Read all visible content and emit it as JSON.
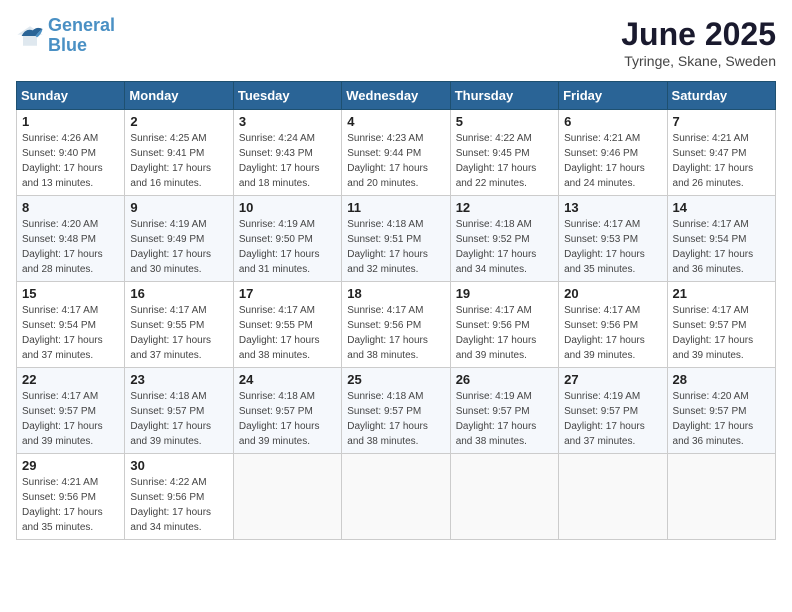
{
  "header": {
    "logo_line1": "General",
    "logo_line2": "Blue",
    "title": "June 2025",
    "subtitle": "Tyringe, Skane, Sweden"
  },
  "columns": [
    "Sunday",
    "Monday",
    "Tuesday",
    "Wednesday",
    "Thursday",
    "Friday",
    "Saturday"
  ],
  "weeks": [
    [
      {
        "day": "1",
        "sunrise": "4:26 AM",
        "sunset": "9:40 PM",
        "daylight": "17 hours and 13 minutes."
      },
      {
        "day": "2",
        "sunrise": "4:25 AM",
        "sunset": "9:41 PM",
        "daylight": "17 hours and 16 minutes."
      },
      {
        "day": "3",
        "sunrise": "4:24 AM",
        "sunset": "9:43 PM",
        "daylight": "17 hours and 18 minutes."
      },
      {
        "day": "4",
        "sunrise": "4:23 AM",
        "sunset": "9:44 PM",
        "daylight": "17 hours and 20 minutes."
      },
      {
        "day": "5",
        "sunrise": "4:22 AM",
        "sunset": "9:45 PM",
        "daylight": "17 hours and 22 minutes."
      },
      {
        "day": "6",
        "sunrise": "4:21 AM",
        "sunset": "9:46 PM",
        "daylight": "17 hours and 24 minutes."
      },
      {
        "day": "7",
        "sunrise": "4:21 AM",
        "sunset": "9:47 PM",
        "daylight": "17 hours and 26 minutes."
      }
    ],
    [
      {
        "day": "8",
        "sunrise": "4:20 AM",
        "sunset": "9:48 PM",
        "daylight": "17 hours and 28 minutes."
      },
      {
        "day": "9",
        "sunrise": "4:19 AM",
        "sunset": "9:49 PM",
        "daylight": "17 hours and 30 minutes."
      },
      {
        "day": "10",
        "sunrise": "4:19 AM",
        "sunset": "9:50 PM",
        "daylight": "17 hours and 31 minutes."
      },
      {
        "day": "11",
        "sunrise": "4:18 AM",
        "sunset": "9:51 PM",
        "daylight": "17 hours and 32 minutes."
      },
      {
        "day": "12",
        "sunrise": "4:18 AM",
        "sunset": "9:52 PM",
        "daylight": "17 hours and 34 minutes."
      },
      {
        "day": "13",
        "sunrise": "4:17 AM",
        "sunset": "9:53 PM",
        "daylight": "17 hours and 35 minutes."
      },
      {
        "day": "14",
        "sunrise": "4:17 AM",
        "sunset": "9:54 PM",
        "daylight": "17 hours and 36 minutes."
      }
    ],
    [
      {
        "day": "15",
        "sunrise": "4:17 AM",
        "sunset": "9:54 PM",
        "daylight": "17 hours and 37 minutes."
      },
      {
        "day": "16",
        "sunrise": "4:17 AM",
        "sunset": "9:55 PM",
        "daylight": "17 hours and 37 minutes."
      },
      {
        "day": "17",
        "sunrise": "4:17 AM",
        "sunset": "9:55 PM",
        "daylight": "17 hours and 38 minutes."
      },
      {
        "day": "18",
        "sunrise": "4:17 AM",
        "sunset": "9:56 PM",
        "daylight": "17 hours and 38 minutes."
      },
      {
        "day": "19",
        "sunrise": "4:17 AM",
        "sunset": "9:56 PM",
        "daylight": "17 hours and 39 minutes."
      },
      {
        "day": "20",
        "sunrise": "4:17 AM",
        "sunset": "9:56 PM",
        "daylight": "17 hours and 39 minutes."
      },
      {
        "day": "21",
        "sunrise": "4:17 AM",
        "sunset": "9:57 PM",
        "daylight": "17 hours and 39 minutes."
      }
    ],
    [
      {
        "day": "22",
        "sunrise": "4:17 AM",
        "sunset": "9:57 PM",
        "daylight": "17 hours and 39 minutes."
      },
      {
        "day": "23",
        "sunrise": "4:18 AM",
        "sunset": "9:57 PM",
        "daylight": "17 hours and 39 minutes."
      },
      {
        "day": "24",
        "sunrise": "4:18 AM",
        "sunset": "9:57 PM",
        "daylight": "17 hours and 39 minutes."
      },
      {
        "day": "25",
        "sunrise": "4:18 AM",
        "sunset": "9:57 PM",
        "daylight": "17 hours and 38 minutes."
      },
      {
        "day": "26",
        "sunrise": "4:19 AM",
        "sunset": "9:57 PM",
        "daylight": "17 hours and 38 minutes."
      },
      {
        "day": "27",
        "sunrise": "4:19 AM",
        "sunset": "9:57 PM",
        "daylight": "17 hours and 37 minutes."
      },
      {
        "day": "28",
        "sunrise": "4:20 AM",
        "sunset": "9:57 PM",
        "daylight": "17 hours and 36 minutes."
      }
    ],
    [
      {
        "day": "29",
        "sunrise": "4:21 AM",
        "sunset": "9:56 PM",
        "daylight": "17 hours and 35 minutes."
      },
      {
        "day": "30",
        "sunrise": "4:22 AM",
        "sunset": "9:56 PM",
        "daylight": "17 hours and 34 minutes."
      },
      null,
      null,
      null,
      null,
      null
    ]
  ]
}
